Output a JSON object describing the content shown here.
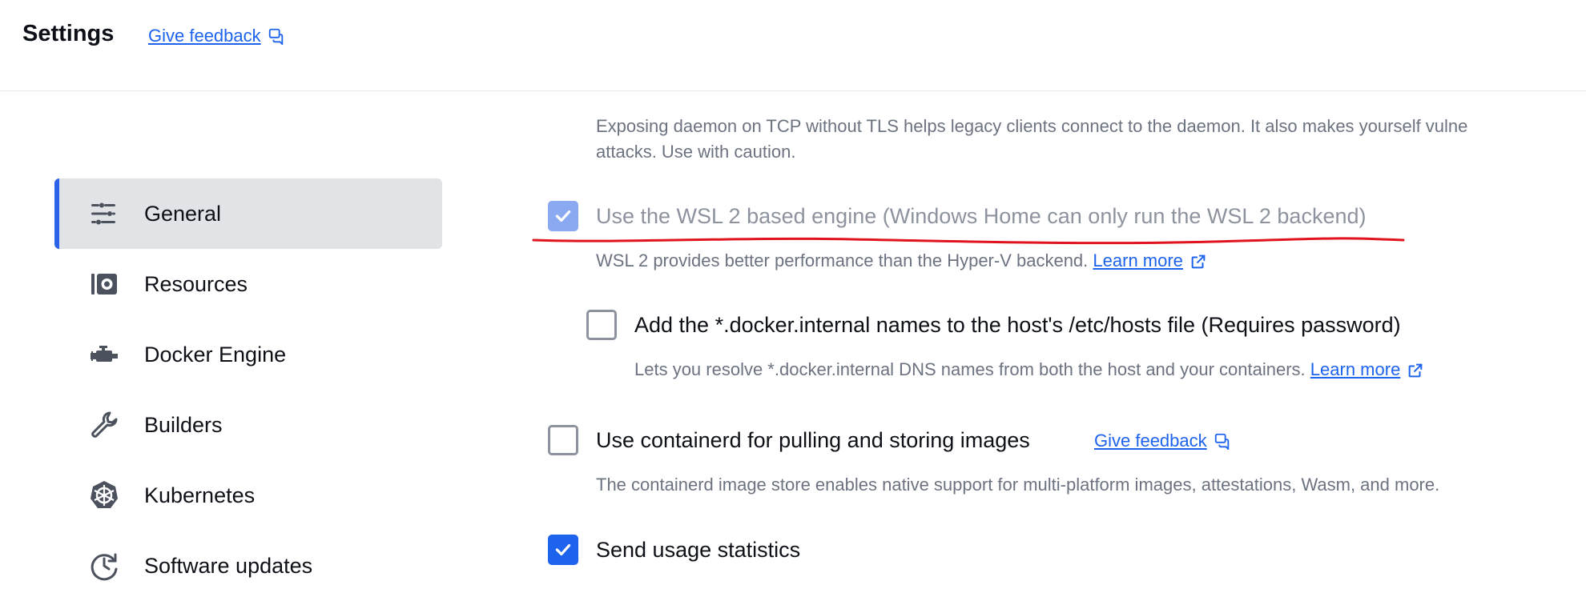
{
  "header": {
    "title": "Settings",
    "feedback_label": "Give feedback"
  },
  "sidebar": {
    "items": [
      {
        "label": "General",
        "icon": "sliders-icon",
        "active": true
      },
      {
        "label": "Resources",
        "icon": "disk-icon",
        "active": false
      },
      {
        "label": "Docker Engine",
        "icon": "engine-icon",
        "active": false
      },
      {
        "label": "Builders",
        "icon": "wrench-icon",
        "active": false
      },
      {
        "label": "Kubernetes",
        "icon": "helm-icon",
        "active": false
      },
      {
        "label": "Software updates",
        "icon": "clock-refresh-icon",
        "active": false
      }
    ]
  },
  "main": {
    "tcp_description": {
      "line1": "Exposing daemon on TCP without TLS helps legacy clients connect to the daemon. It also makes yourself vulne",
      "line2": "attacks. Use with caution."
    },
    "wsl": {
      "label": "Use the WSL 2 based engine (Windows Home can only run the WSL 2 backend)",
      "checked": true,
      "disabled": true,
      "description": "WSL 2 provides better performance than the Hyper-V backend.",
      "learn_more": "Learn more"
    },
    "hosts": {
      "label": "Add the *.docker.internal names to the host's /etc/hosts file (Requires password)",
      "checked": false,
      "description": "Lets you resolve *.docker.internal DNS names from both the host and your containers.",
      "learn_more": "Learn more"
    },
    "containerd": {
      "label": "Use containerd for pulling and storing images",
      "checked": false,
      "feedback_label": "Give feedback",
      "description": "The containerd image store enables native support for multi-platform images, attestations, Wasm, and more."
    },
    "usage": {
      "label": "Send usage statistics",
      "checked": true
    }
  },
  "colors": {
    "accent": "#1d63ed",
    "annotation": "#e0141e",
    "active_bg": "#e1e3e7",
    "muted_text": "#6c7380"
  }
}
